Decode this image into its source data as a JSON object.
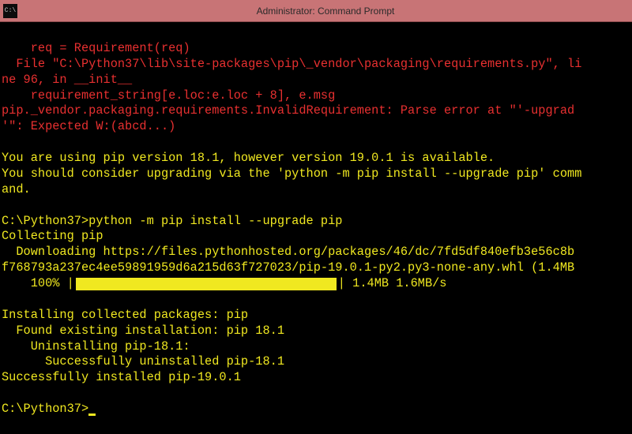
{
  "window": {
    "title": "Administrator: Command Prompt",
    "icon_label": "C:\\"
  },
  "error": {
    "line1": "    req = Requirement(req)",
    "line2": "  File \"C:\\Python37\\lib\\site-packages\\pip\\_vendor\\packaging\\requirements.py\", li",
    "line3": "ne 96, in __init__",
    "line4": "    requirement_string[e.loc:e.loc + 8], e.msg",
    "line5": "pip._vendor.packaging.requirements.InvalidRequirement: Parse error at \"'-upgrad",
    "line6": "'\": Expected W:(abcd...)"
  },
  "notice": {
    "line1": "You are using pip version 18.1, however version 19.0.1 is available.",
    "line2": "You should consider upgrading via the 'python -m pip install --upgrade pip' comm",
    "line3": "and."
  },
  "command": {
    "prompt1": "C:\\Python37>",
    "cmd": "python -m pip install --upgrade pip",
    "collecting": "Collecting pip",
    "download1": "  Downloading https://files.pythonhosted.org/packages/46/dc/7fd5df840efb3e56c8b",
    "download2": "f768793a237ec4ee59891959d6a215d63f727023/pip-19.0.1-py2.py3-none-any.whl (1.4MB",
    "progress_pct": "    100% |",
    "progress_stats": "| 1.4MB 1.6MB/s",
    "installing": "Installing collected packages: pip",
    "found": "  Found existing installation: pip 18.1",
    "uninstalling": "    Uninstalling pip-18.1:",
    "success_uninstall": "      Successfully uninstalled pip-18.1",
    "success_install": "Successfully installed pip-19.0.1",
    "prompt2": "C:\\Python37>"
  }
}
